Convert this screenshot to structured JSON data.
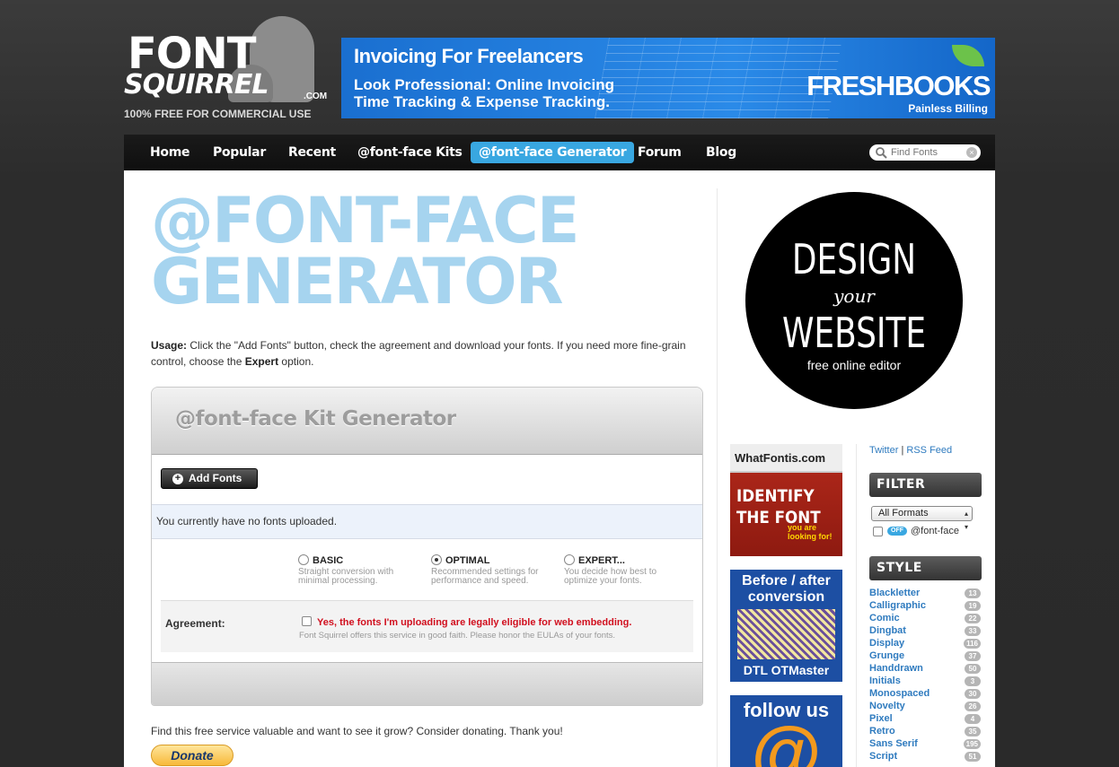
{
  "logo": {
    "font": "FONT",
    "squirrel": "SQUIRREL",
    "com": ".COM",
    "tagline": "100% FREE FOR COMMERCIAL USE"
  },
  "banner": {
    "headline": "Invoicing For Freelancers",
    "subline": "Look Professional: Online Invoicing Time Tracking & Expense Tracking.",
    "brand": "FRESHBOOKS",
    "brand_tag": "Painless Billing"
  },
  "nav": {
    "items": [
      "Home",
      "Popular",
      "Recent",
      "@font-face Kits",
      "@font-face Generator",
      "Forum",
      "Blog"
    ],
    "active": "@font-face Generator"
  },
  "search": {
    "placeholder": "Find Fonts",
    "clear": "×"
  },
  "main": {
    "title": "@FONT-FACE GENERATOR",
    "usage_label": "Usage:",
    "usage_text_1": " Click the \"Add Fonts\" button, check the agreement and download your fonts. If you need more fine-grain control, choose the ",
    "usage_expert": "Expert",
    "usage_text_2": " option."
  },
  "generator": {
    "title": "@font-face Kit Generator",
    "add_button": "Add Fonts",
    "no_fonts": "You currently have no fonts uploaded.",
    "options": [
      {
        "label": "BASIC",
        "desc": "Straight conversion with minimal processing.",
        "selected": false
      },
      {
        "label": "OPTIMAL",
        "desc": "Recommended settings for performance and speed.",
        "selected": true
      },
      {
        "label": "EXPERT...",
        "desc": "You decide how best to optimize your fonts.",
        "selected": false
      }
    ],
    "agreement_label": "Agreement:",
    "agreement_text": "Yes, the fonts I'm uploading are legally eligible for web embedding.",
    "agreement_note": "Font Squirrel offers this service in good faith. Please honor the EULAs of your fonts.",
    "agreement_checked": false
  },
  "donate": {
    "text": "Find this free service valuable and want to see it grow? Consider donating. Thank you!",
    "button": "Donate"
  },
  "design_ad": {
    "line1": "DESIGN",
    "line2": "your",
    "line3": "WEBSITE",
    "line4": "free online editor"
  },
  "ads": {
    "whatfontis": {
      "brand": "WhatFontis.com",
      "big": "IDENTIFY THE FONT",
      "small": "you are looking for!"
    },
    "otmaster": {
      "top": "Before / after conversion",
      "bottom": "DTL OTMaster"
    },
    "follow": {
      "text": "follow us",
      "symbol": "@"
    }
  },
  "sidebar": {
    "twitter": "Twitter",
    "separator": " | ",
    "rss": "RSS Feed",
    "filter_title": "FILTER",
    "formats_select": "All Formats",
    "fontface_toggle": "OFF",
    "fontface_label": "@font-face",
    "style_title": "STYLE",
    "styles": [
      {
        "name": "Blackletter",
        "count": "13"
      },
      {
        "name": "Calligraphic",
        "count": "19"
      },
      {
        "name": "Comic",
        "count": "22"
      },
      {
        "name": "Dingbat",
        "count": "33"
      },
      {
        "name": "Display",
        "count": "116"
      },
      {
        "name": "Grunge",
        "count": "37"
      },
      {
        "name": "Handdrawn",
        "count": "50"
      },
      {
        "name": "Initials",
        "count": "3"
      },
      {
        "name": "Monospaced",
        "count": "30"
      },
      {
        "name": "Novelty",
        "count": "26"
      },
      {
        "name": "Pixel",
        "count": "4"
      },
      {
        "name": "Retro",
        "count": "35"
      },
      {
        "name": "Sans Serif",
        "count": "195"
      },
      {
        "name": "Script",
        "count": "51"
      }
    ]
  },
  "colors": {
    "accent": "#39a7e1",
    "title": "#a6d4ef",
    "link": "#2f7bbf",
    "warning": "#d1101f"
  }
}
